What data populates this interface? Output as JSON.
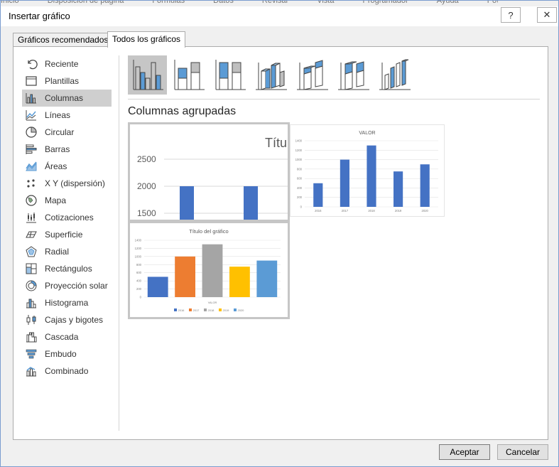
{
  "window": {
    "title": "Insertar gráfico",
    "help_label": "?",
    "close_label": "✕"
  },
  "ribbon_peek": [
    "Inicio",
    "Disposición de página",
    "Fórmulas",
    "Datos",
    "Revisar",
    "Vista",
    "Programador",
    "Ayuda",
    "Power Pivot"
  ],
  "tabs": [
    {
      "label": "Gráficos recomendados",
      "active": false
    },
    {
      "label": "Todos los gráficos",
      "active": true
    }
  ],
  "sidebar": {
    "items": [
      {
        "label": "Reciente",
        "icon": "recent-icon"
      },
      {
        "label": "Plantillas",
        "icon": "templates-icon"
      },
      {
        "label": "Columnas",
        "icon": "column-chart-icon",
        "selected": true
      },
      {
        "label": "Líneas",
        "icon": "line-chart-icon"
      },
      {
        "label": "Circular",
        "icon": "pie-chart-icon"
      },
      {
        "label": "Barras",
        "icon": "bar-chart-icon"
      },
      {
        "label": "Áreas",
        "icon": "area-chart-icon"
      },
      {
        "label": "X Y (dispersión)",
        "icon": "scatter-chart-icon"
      },
      {
        "label": "Mapa",
        "icon": "map-chart-icon"
      },
      {
        "label": "Cotizaciones",
        "icon": "stock-chart-icon"
      },
      {
        "label": "Superficie",
        "icon": "surface-chart-icon"
      },
      {
        "label": "Radial",
        "icon": "radar-chart-icon"
      },
      {
        "label": "Rectángulos",
        "icon": "treemap-chart-icon"
      },
      {
        "label": "Proyección solar",
        "icon": "sunburst-chart-icon"
      },
      {
        "label": "Histograma",
        "icon": "histogram-chart-icon"
      },
      {
        "label": "Cajas y bigotes",
        "icon": "box-whisker-chart-icon"
      },
      {
        "label": "Cascada",
        "icon": "waterfall-chart-icon"
      },
      {
        "label": "Embudo",
        "icon": "funnel-chart-icon"
      },
      {
        "label": "Combinado",
        "icon": "combo-chart-icon"
      }
    ]
  },
  "subtypes": [
    {
      "icon": "clustered-column-icon",
      "selected": true
    },
    {
      "icon": "stacked-column-icon"
    },
    {
      "icon": "stacked-100-column-icon"
    },
    {
      "icon": "3d-clustered-column-icon"
    },
    {
      "icon": "3d-stacked-column-icon"
    },
    {
      "icon": "3d-stacked-100-column-icon"
    },
    {
      "icon": "3d-column-icon"
    }
  ],
  "selected_subtype_title": "Columnas agrupadas",
  "colors": {
    "blue": "#4472c4",
    "orange": "#ed7d31",
    "gray": "#a5a5a5",
    "gold": "#ffc000",
    "lightblue": "#5b9bd5",
    "icon_blue": "#5b9bd5"
  },
  "previews": {
    "zoomed": {
      "title_fragment": "Títu",
      "y_ticks": [
        "2500",
        "2000",
        "1500"
      ]
    },
    "single_series": {
      "title": "VALOR",
      "chart_data": {
        "type": "bar",
        "title": "VALOR",
        "categories": [
          "2016",
          "2017",
          "2018",
          "2019",
          "2020"
        ],
        "values": [
          500,
          1000,
          1300,
          750,
          900
        ],
        "ylim": [
          0,
          1400
        ],
        "y_ticks": [
          "0",
          "200",
          "400",
          "600",
          "800",
          "1000",
          "1200",
          "1400"
        ]
      }
    },
    "multi_color": {
      "title": "Título del gráfico",
      "xlabel": "VALOR",
      "chart_data": {
        "type": "bar",
        "title": "Título del gráfico",
        "xlabel": "VALOR",
        "categories": [
          "2016",
          "2017",
          "2018",
          "2019",
          "2020"
        ],
        "values": [
          500,
          1000,
          1300,
          750,
          900
        ],
        "ylim": [
          0,
          1400
        ],
        "y_ticks": [
          "0",
          "200",
          "400",
          "600",
          "800",
          "1000",
          "1200",
          "1400"
        ],
        "legend": [
          "2016",
          "2017",
          "2018",
          "2019",
          "2020"
        ]
      }
    }
  },
  "buttons": {
    "accept": "Aceptar",
    "cancel": "Cancelar"
  }
}
